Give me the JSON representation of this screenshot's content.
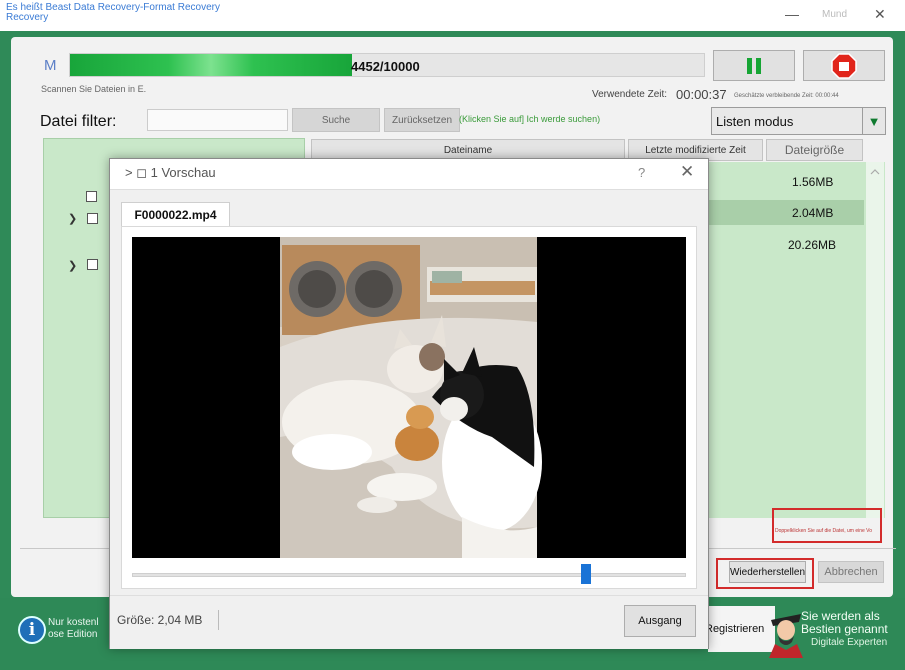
{
  "window": {
    "title": "Es heißt Beast Data Recovery-Format Recovery Recovery",
    "minimize": "—",
    "mode_label": "Mund",
    "close": "✕"
  },
  "scan": {
    "logo_letter": "M",
    "progress_text": "4452/10000",
    "progress_fraction": 0.4452,
    "scanning_label": "Scannen Sie Dateien in E.",
    "elapsed_label": "Verwendete Zeit:",
    "elapsed_value": "00:00:37",
    "remaining_label": "Geschätzte verbleibende Zeit: 00:00:44"
  },
  "filter": {
    "label": "Datei filter:",
    "input_value": "",
    "search_button": "Suche",
    "reset_button": "Zurücksetzen",
    "hint": "(Klicken Sie auf] Ich werde suchen)",
    "mode": "Listen modus"
  },
  "table": {
    "headers": [
      "Dateiname",
      "Letzte modifizierte Zeit",
      "Dateigröße"
    ],
    "sizes": [
      "1.56MB",
      "2.04MB",
      "20.26MB"
    ]
  },
  "actions": {
    "note": "Doppelklicken Sie auf die Datei, um eine Vo",
    "restore": "Wiederherstellen",
    "abort": "Abbrechen"
  },
  "footer": {
    "info_glyph": "i",
    "free_line1": "Nur kostenl",
    "free_line2": "ose Edition",
    "register": "Registrieren",
    "best_line1": "Sie werden als",
    "best_line2": "Bestien genannt",
    "digital": "Digitale Experten"
  },
  "preview": {
    "title": "> ◻ 1 Vorschau",
    "help": "?",
    "close": "✕",
    "tab": "F0000022.mp4",
    "playback_fraction": 0.82,
    "size_label": "Größe: 2,04 MB",
    "exit_button": "Ausgang"
  },
  "colors": {
    "background_green": "#2f8a58",
    "progress_green": "#18a53a",
    "list_green": "#c9e8c9",
    "highlight_red": "#d32b2b",
    "slider_blue": "#1a73d6"
  }
}
